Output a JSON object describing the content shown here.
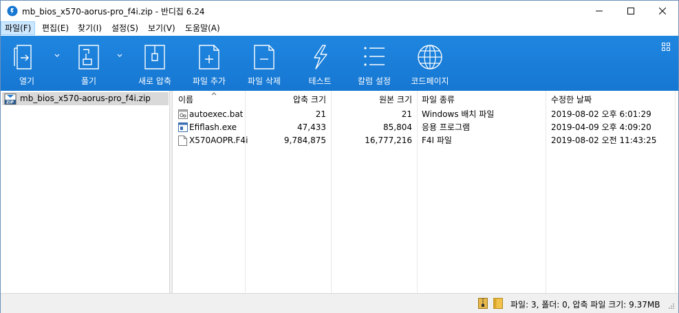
{
  "window": {
    "title": "mb_bios_x570-aorus-pro_f4i.zip - 반디집 6.24"
  },
  "menu": [
    {
      "label": "파일(F)"
    },
    {
      "label": "편집(E)"
    },
    {
      "label": "찾기(I)"
    },
    {
      "label": "설정(S)"
    },
    {
      "label": "보기(V)"
    },
    {
      "label": "도움말(A)"
    }
  ],
  "toolbar": {
    "open": "열기",
    "extract": "풀기",
    "new_archive": "새로 압축",
    "add_file": "파일 추가",
    "delete_file": "파일 삭제",
    "test": "테스트",
    "columns": "칼럼 설정",
    "codepage": "코드페이지"
  },
  "tree": {
    "archive": "mb_bios_x570-aorus-pro_f4i.zip"
  },
  "columns": [
    "이름",
    "압축 크기",
    "원본 크기",
    "파일 종류",
    "수정한 날짜"
  ],
  "files": [
    {
      "name": "autoexec.bat",
      "packed": "21",
      "size": "21",
      "type": "Windows 배치 파일",
      "modified": "2019-08-02 오후 6:01:29",
      "icon": "batch-file-icon"
    },
    {
      "name": "Efiflash.exe",
      "packed": "47,433",
      "size": "85,804",
      "type": "응용 프로그램",
      "modified": "2019-04-09 오후 4:09:20",
      "icon": "exe-file-icon"
    },
    {
      "name": "X570AOPR.F4i",
      "packed": "9,784,875",
      "size": "16,777,216",
      "type": "F4I 파일",
      "modified": "2019-08-02 오전 11:43:25",
      "icon": "generic-file-icon"
    }
  ],
  "status": {
    "text": "파일: 3, 폴더: 0, 압축 파일 크기: 9.37MB"
  },
  "colors": {
    "toolbar": "#1677d2",
    "menu_active": "#cce8ff",
    "selection": "#d9d9d9"
  }
}
